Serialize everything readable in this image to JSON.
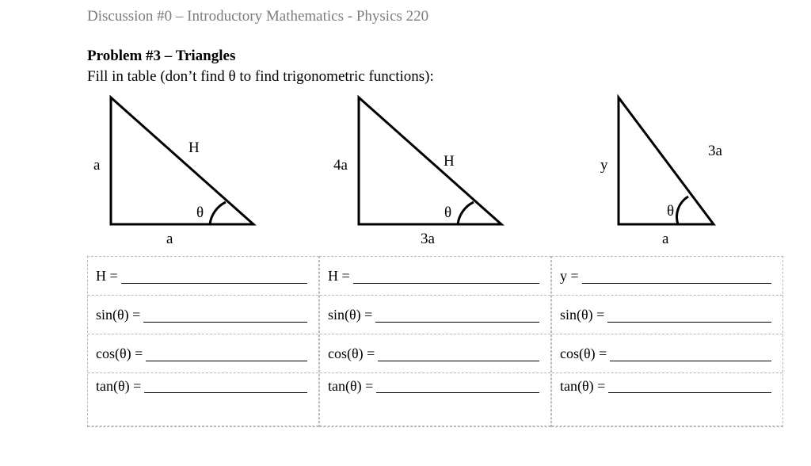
{
  "header": "Discussion #0 – Introductory Mathematics - Physics 220",
  "problem_title": "Problem #3 – Triangles",
  "instruction": "Fill in table (don’t find θ to find trigonometric functions):",
  "cols": [
    {
      "tri": {
        "vert": "a",
        "hyp": "H",
        "base": "a",
        "angle": "θ"
      },
      "rows": [
        "H =",
        "sin(θ) =",
        "cos(θ) =",
        "tan(θ) ="
      ]
    },
    {
      "tri": {
        "vert": "4a",
        "hyp": "H",
        "base": "3a",
        "angle": "θ"
      },
      "rows": [
        "H =",
        "sin(θ) =",
        "cos(θ) =",
        "tan(θ) ="
      ]
    },
    {
      "tri": {
        "vert": "y",
        "hyp": "3a",
        "base": "a",
        "angle": "θ"
      },
      "rows": [
        "y =",
        "sin(θ) =",
        "cos(θ) =",
        "tan(θ) ="
      ]
    }
  ]
}
